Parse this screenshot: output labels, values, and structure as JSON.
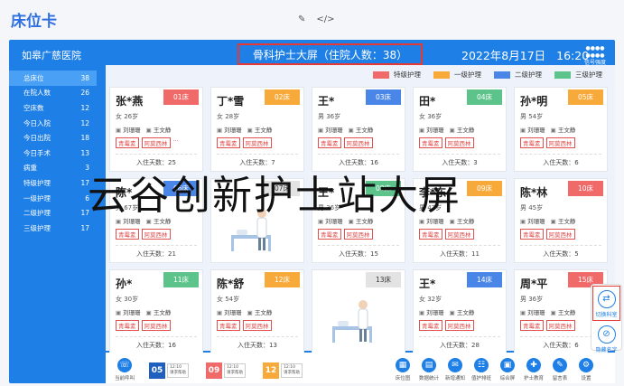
{
  "page_title": "床位卡",
  "toolbar_icons": [
    "edit-icon",
    "code-icon"
  ],
  "hospital": "如皋广慈医院",
  "sidebar": [
    {
      "label": "总床位",
      "count": "38"
    },
    {
      "label": "在院人数",
      "count": "26"
    },
    {
      "label": "空床数",
      "count": "12"
    },
    {
      "label": "今日入院",
      "count": "12"
    },
    {
      "label": "今日出院",
      "count": "18"
    },
    {
      "label": "今日手术",
      "count": "13"
    },
    {
      "label": "病重",
      "count": "3"
    },
    {
      "label": "特级护理",
      "count": "17"
    },
    {
      "label": "一级护理",
      "count": "6"
    },
    {
      "label": "二级护理",
      "count": "17"
    },
    {
      "label": "三级护理",
      "count": "17"
    }
  ],
  "header": {
    "title": "骨科护士大屏（住院人数：38）",
    "date": "2022年8月17日",
    "time": "16:20",
    "signal_text": "信号强度"
  },
  "legend": [
    {
      "label": "特级护理",
      "color": "#f06a6a"
    },
    {
      "label": "一级护理",
      "color": "#f7a93a"
    },
    {
      "label": "二级护理",
      "color": "#4a86e8"
    },
    {
      "label": "三级护理",
      "color": "#5cc48a"
    }
  ],
  "days_label": "入住天数",
  "cards": [
    {
      "name": "张*燕",
      "bed": "01床",
      "color": "#f06a6a",
      "info": "女  26岁",
      "doctor": "刘珊珊",
      "nurse": "王文静",
      "tags": [
        "青霉素",
        "阿莫西林"
      ],
      "more": "···",
      "days": "25"
    },
    {
      "name": "丁*雪",
      "bed": "02床",
      "color": "#f7a93a",
      "info": "女  28岁",
      "doctor": "刘珊珊",
      "nurse": "王文静",
      "tags": [
        "青霉素",
        "阿莫西林"
      ],
      "days": "7"
    },
    {
      "name": "王*",
      "bed": "03床",
      "color": "#4a86e8",
      "info": "男  36岁",
      "doctor": "刘珊珊",
      "nurse": "王文静",
      "tags": [
        "青霉素",
        "阿莫西林"
      ],
      "days": "16"
    },
    {
      "name": "田*",
      "bed": "04床",
      "color": "#5cc48a",
      "info": "女  36岁",
      "doctor": "刘珊珊",
      "nurse": "王文静",
      "tags": [
        "青霉素",
        "阿莫西林"
      ],
      "days": "3"
    },
    {
      "name": "孙*明",
      "bed": "05床",
      "color": "#f7a93a",
      "info": "男  54岁",
      "doctor": "刘珊珊",
      "nurse": "王文静",
      "tags": [
        "青霉素",
        "阿莫西林"
      ],
      "days": "6"
    },
    {
      "name": "陈*",
      "bed": "06床",
      "color": "#4a86e8",
      "info": "男  67岁",
      "doctor": "刘珊珊",
      "nurse": "王文静",
      "tags": [
        "青霉素",
        "阿莫西林"
      ],
      "days": "21"
    },
    {
      "name": "",
      "bed": "07床",
      "color": "#e0e0e0",
      "empty": true
    },
    {
      "name": "王*",
      "bed": "08床",
      "color": "#5cc48a",
      "info": "男  36岁",
      "doctor": "刘珊珊",
      "nurse": "王文静",
      "tags": [
        "青霉素",
        "阿莫西林"
      ],
      "days": "15"
    },
    {
      "name": "李*东",
      "bed": "09床",
      "color": "#f7a93a",
      "info": "男  42岁",
      "doctor": "刘珊珊",
      "nurse": "王文静",
      "tags": [
        "青霉素",
        "阿莫西林"
      ],
      "days": "11"
    },
    {
      "name": "陈*林",
      "bed": "10床",
      "color": "#f06a6a",
      "info": "男  45岁",
      "doctor": "刘珊珊",
      "nurse": "王文静",
      "tags": [
        "青霉素",
        "阿莫西林"
      ],
      "days": "5"
    },
    {
      "name": "孙*",
      "bed": "11床",
      "color": "#5cc48a",
      "info": "女  30岁",
      "doctor": "刘珊珊",
      "nurse": "王文静",
      "tags": [
        "青霉素",
        "阿莫西林"
      ],
      "days": "16"
    },
    {
      "name": "陈*舒",
      "bed": "12床",
      "color": "#f7a93a",
      "info": "女  54岁",
      "doctor": "刘珊珊",
      "nurse": "王文静",
      "tags": [
        "青霉素",
        "阿莫西林"
      ],
      "days": "13"
    },
    {
      "name": "",
      "bed": "13床",
      "color": "#e0e0e0",
      "empty": true
    },
    {
      "name": "王*",
      "bed": "14床",
      "color": "#4a86e8",
      "info": "女  32岁",
      "doctor": "刘珊珊",
      "nurse": "王文静",
      "tags": [
        "青霉素",
        "阿莫西林"
      ],
      "days": "28"
    },
    {
      "name": "周*平",
      "bed": "15床",
      "color": "#f06a6a",
      "info": "男  36岁",
      "doctor": "刘珊珊",
      "nurse": "王文静",
      "tags": [
        "青霉素",
        "阿莫西林"
      ],
      "days": "6"
    }
  ],
  "bottom": {
    "call_label": "当前呼叫",
    "alerts": [
      {
        "num": "05",
        "color": "#1e5fc0",
        "time": "12:10",
        "text": "请求帮助"
      },
      {
        "num": "09",
        "color": "#f06a6a",
        "time": "12:10",
        "text": "请求帮助"
      },
      {
        "num": "12",
        "color": "#f7a93a",
        "time": "12:10",
        "text": "请求帮助"
      }
    ],
    "buttons": [
      "床位图",
      "数据统计",
      "新增通知",
      "值护排班",
      "综合屏",
      "护士教育",
      "留言表",
      "设置"
    ]
  },
  "float": [
    {
      "label": "切换科室",
      "icon": "swap-icon"
    },
    {
      "label": "隐藏名字",
      "icon": "eye-off-icon"
    }
  ],
  "watermark": "云谷创新护士站大屏"
}
